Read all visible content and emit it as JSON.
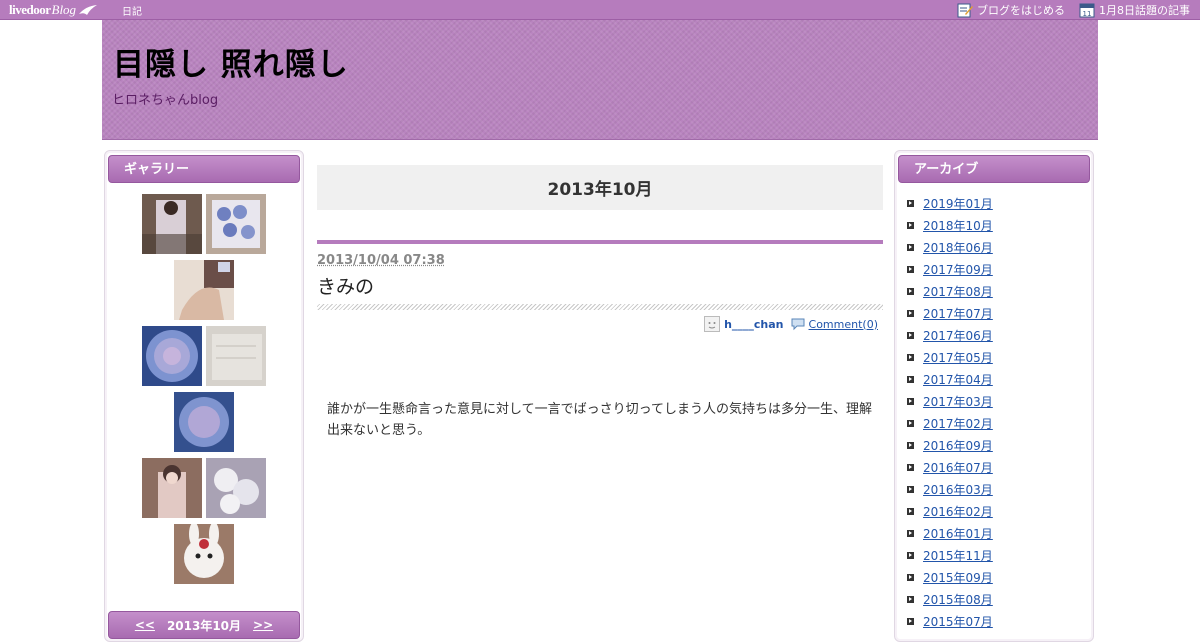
{
  "topbar": {
    "logo_text": "livedoor",
    "logo_blog": "Blog",
    "diary_link": "日記",
    "start_blog": "ブログをはじめる",
    "trending": "1月8日話題の記事"
  },
  "header": {
    "title": "目隠し 照れ隠し",
    "subtitle": "ヒロネちゃんblog"
  },
  "gallery": {
    "heading": "ギャラリー",
    "thumbs": [
      {
        "icon": "photo-icon",
        "color": "#8a6a5a"
      },
      {
        "icon": "photo-icon",
        "color": "#9aa4c4"
      },
      {
        "icon": "photo-icon",
        "color": "#d7c6b8"
      },
      {
        "icon": "photo-icon",
        "color": "#6d7fb8"
      },
      {
        "icon": "photo-icon",
        "color": "#cfcbc7"
      },
      {
        "icon": "photo-icon",
        "color": "#6d7fb8"
      },
      {
        "icon": "photo-icon",
        "color": "#a07a6d"
      },
      {
        "icon": "photo-icon",
        "color": "#c9c0cf"
      },
      {
        "icon": "photo-icon",
        "color": "#c7a892"
      }
    ]
  },
  "calendar": {
    "prev": "<<",
    "month": "2013年10月",
    "next": ">>"
  },
  "main": {
    "month_heading": "2013年10月",
    "post": {
      "date": "2013/10/04 07:38",
      "title": "きみの",
      "author": "h____chan",
      "comments": "Comment(0)",
      "body": "誰かが一生懸命言った意見に対して一言でばっさり切ってしまう人の気持ちは多分一生、理解出来ないと思う。"
    }
  },
  "archive": {
    "heading": "アーカイブ",
    "items": [
      "2019年01月",
      "2018年10月",
      "2018年06月",
      "2017年09月",
      "2017年08月",
      "2017年07月",
      "2017年06月",
      "2017年05月",
      "2017年04月",
      "2017年03月",
      "2017年02月",
      "2016年09月",
      "2016年07月",
      "2016年03月",
      "2016年02月",
      "2016年01月",
      "2015年11月",
      "2015年09月",
      "2015年08月",
      "2015年07月"
    ]
  },
  "colors": {
    "accent": "#b67cbd",
    "link": "#2255aa"
  }
}
